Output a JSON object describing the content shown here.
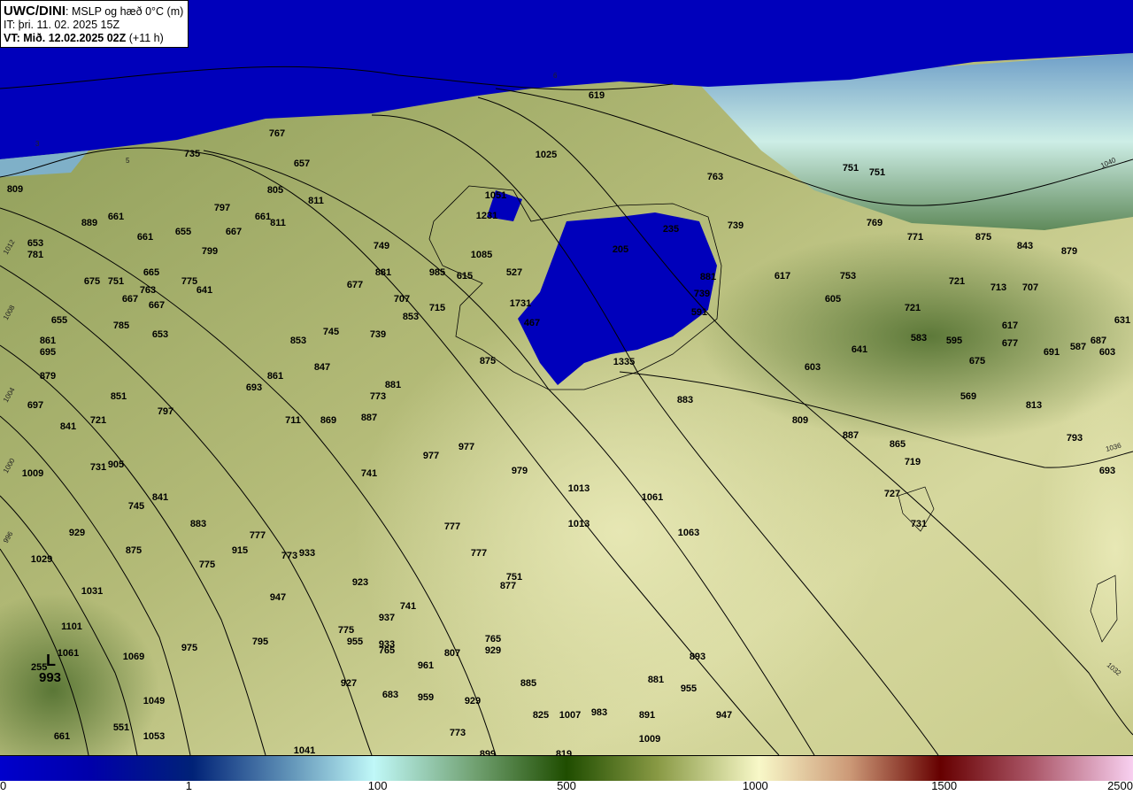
{
  "header": {
    "model": "UWC/DINI",
    "title": ": MSLP og hæð 0°C (m)",
    "issue_time": "IT: þri. 11. 02. 2025 15Z",
    "valid_time_bold": "VT: Mið. 12.02.2025 02Z",
    "valid_time_offset": " (+11 h)"
  },
  "colorbar": {
    "ticks": [
      "0",
      "1",
      "100",
      "500",
      "1000",
      "1500",
      "2500"
    ],
    "colors": [
      "#0000cc",
      "#002277",
      "#6699bb",
      "#c0f8f8",
      "#70a070",
      "#1f4d00",
      "#889944",
      "#f8f8c8",
      "#cc9977",
      "#660000",
      "#aa5566",
      "#f8d0f0"
    ]
  },
  "map": {
    "low_marker": "L",
    "low_value": "993",
    "low_height": "255",
    "isobar_labels": [
      "1012",
      "1008",
      "1004",
      "1000",
      "996",
      "1040",
      "1036",
      "1032",
      "3",
      "5",
      "6"
    ],
    "height_labels": [
      "767",
      "657",
      "735",
      "809",
      "805",
      "811",
      "889",
      "661",
      "797",
      "661",
      "811",
      "653",
      "781",
      "661",
      "655",
      "667",
      "799",
      "749",
      "1025",
      "619",
      "763",
      "751",
      "751",
      "739",
      "769",
      "771",
      "875",
      "843",
      "879",
      "675",
      "751",
      "665",
      "763",
      "775",
      "641",
      "667",
      "667",
      "881",
      "677",
      "985",
      "615",
      "527",
      "1085",
      "707",
      "715",
      "853",
      "617",
      "753",
      "721",
      "713",
      "707",
      "605",
      "721",
      "655",
      "785",
      "653",
      "853",
      "745",
      "739",
      "861",
      "695",
      "583",
      "595",
      "677",
      "617",
      "691",
      "587",
      "687",
      "603",
      "631",
      "641",
      "875",
      "603",
      "675",
      "879",
      "847",
      "861",
      "693",
      "881",
      "773",
      "851",
      "569",
      "813",
      "697",
      "797",
      "883",
      "711",
      "869",
      "887",
      "721",
      "841",
      "809",
      "887",
      "865",
      "719",
      "793",
      "977",
      "977",
      "731",
      "905",
      "1009",
      "741",
      "979",
      "693",
      "1013",
      "1061",
      "727",
      "841",
      "745",
      "883",
      "929",
      "777",
      "1063",
      "1013",
      "777",
      "731",
      "875",
      "915",
      "773",
      "933",
      "1029",
      "775",
      "777",
      "751",
      "877",
      "923",
      "1031",
      "947",
      "741",
      "937",
      "1101",
      "775",
      "955",
      "933",
      "765",
      "765",
      "929",
      "795",
      "975",
      "1061",
      "1069",
      "807",
      "961",
      "893",
      "881",
      "955",
      "927",
      "683",
      "959",
      "885",
      "929",
      "1049",
      "825",
      "1007",
      "983",
      "891",
      "947",
      "551",
      "773",
      "1053",
      "661",
      "1009",
      "1041",
      "899",
      "819",
      "1051",
      "1231",
      "205",
      "235",
      "1731",
      "467",
      "1335",
      "739",
      "881",
      "591"
    ]
  }
}
